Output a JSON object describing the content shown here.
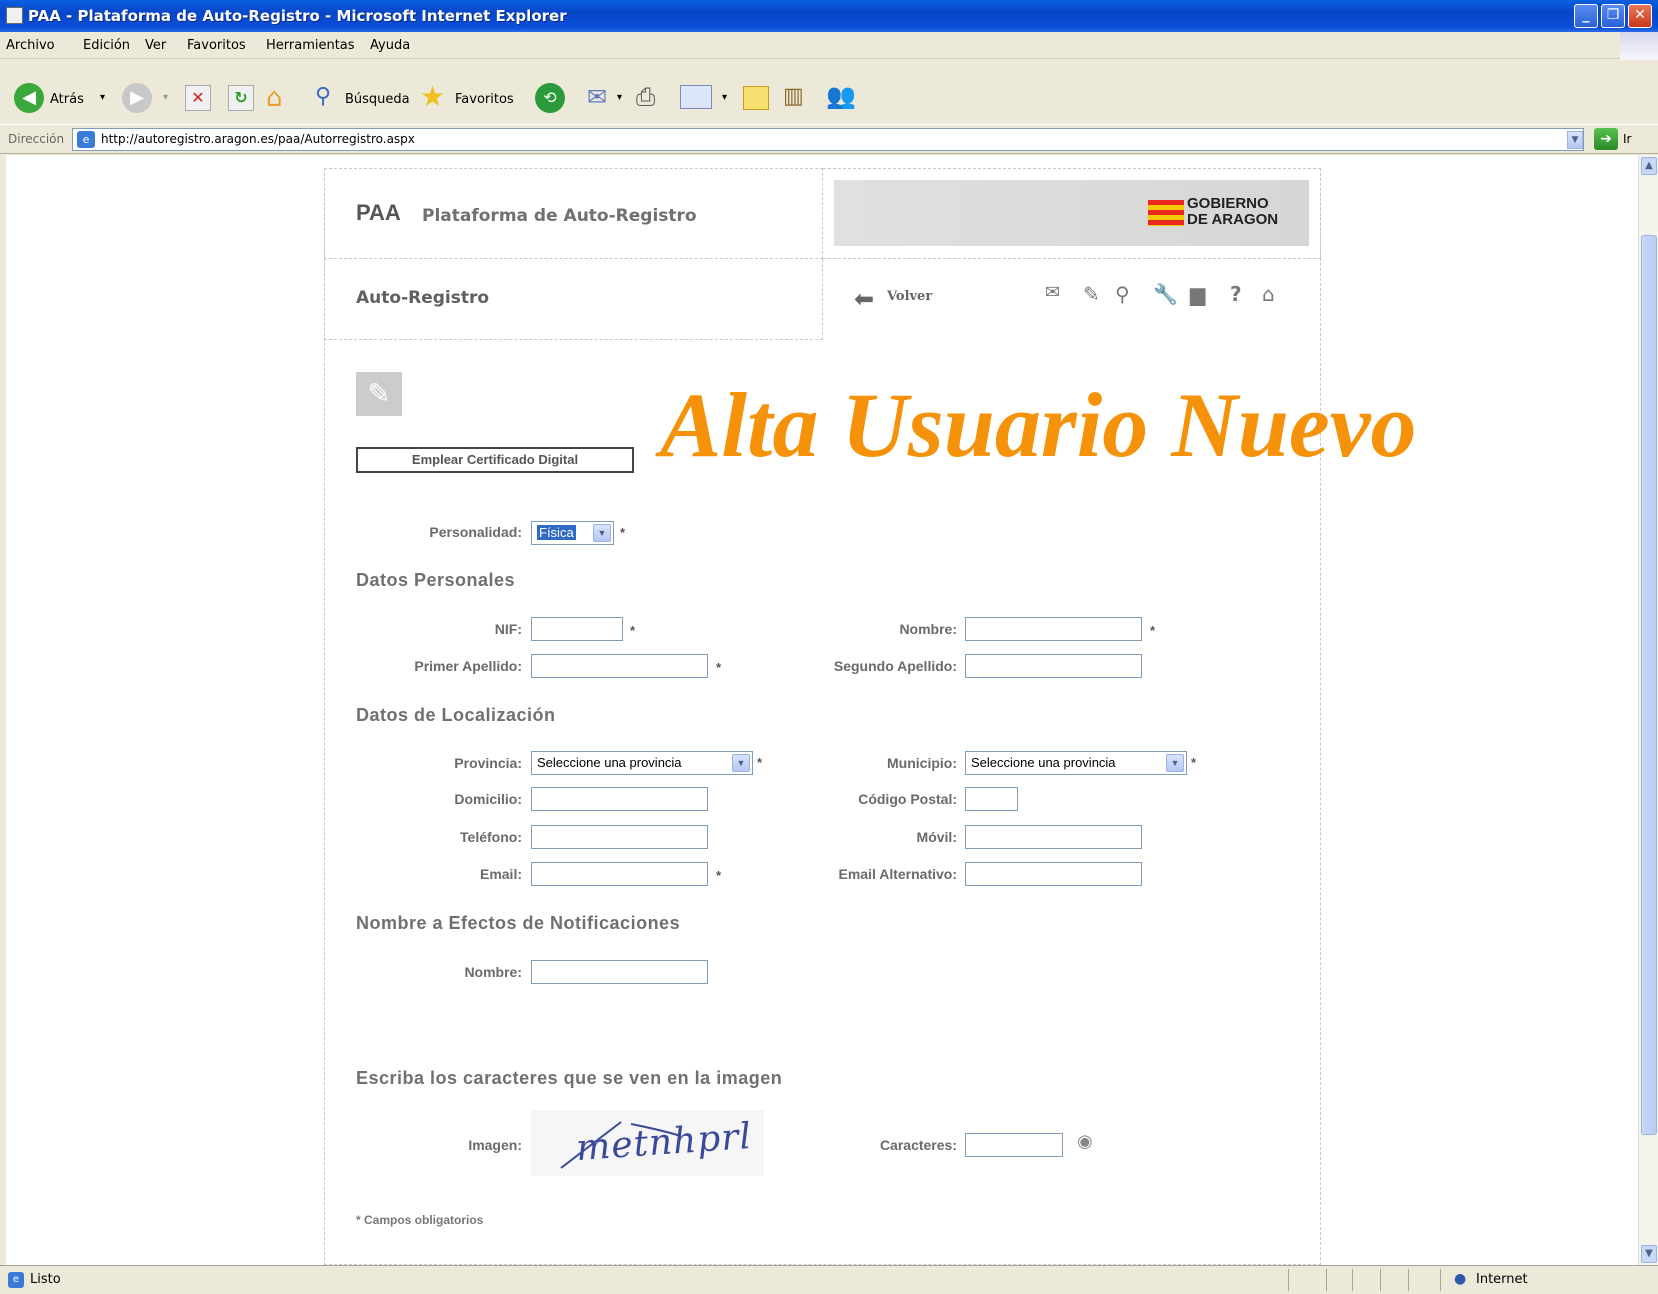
{
  "window": {
    "title": "PAA - Plataforma de Auto-Registro - Microsoft Internet Explorer"
  },
  "menu": [
    "Archivo",
    "Edición",
    "Ver",
    "Favoritos",
    "Herramientas",
    "Ayuda"
  ],
  "toolbar": {
    "back_label": "Atrás",
    "search_label": "Búsqueda",
    "favorites_label": "Favoritos"
  },
  "address": {
    "label": "Dirección",
    "url": "http://autoregistro.aragon.es/paa/Autorregistro.aspx",
    "go_label": "Ir"
  },
  "page": {
    "brand": "PAA",
    "brand_sub": "Plataforma de Auto-Registro",
    "gov_logo_line1": "GOBIERNO",
    "gov_logo_line2": "DE ARAGON",
    "section_title": "Auto-Registro",
    "back_link": "Volver",
    "cert_button": "Emplear Certificado Digital",
    "overlay_title": "Alta Usuario Nuevo",
    "personalidad_label": "Personalidad:",
    "personalidad_value": "Física",
    "datos_personales": "Datos Personales",
    "nif_label": "NIF:",
    "nombre_label": "Nombre:",
    "primer_apellido_label": "Primer Apellido:",
    "segundo_apellido_label": "Segundo Apellido:",
    "datos_localizacion": "Datos de Localización",
    "provincia_label": "Provincia:",
    "provincia_value": "Seleccione una provincia",
    "municipio_label": "Municipio:",
    "municipio_value": "Seleccione una provincia",
    "domicilio_label": "Domicilio:",
    "codigo_postal_label": "Código Postal:",
    "telefono_label": "Teléfono:",
    "movil_label": "Móvil:",
    "email_label": "Email:",
    "email_alt_label": "Email Alternativo:",
    "notificaciones": "Nombre a Efectos de Notificaciones",
    "notif_nombre_label": "Nombre:",
    "captcha_heading": "Escriba los caracteres que se ven en la imagen",
    "imagen_label": "Imagen:",
    "captcha_text": "metnhprl",
    "caracteres_label": "Caracteres:",
    "required_note": "* Campos obligatorios",
    "asterisk": "*"
  },
  "status": {
    "text": "Listo",
    "zone": "Internet"
  },
  "colors": {
    "overlay": "#f5920a",
    "titlebar": "#0a4fd8"
  }
}
